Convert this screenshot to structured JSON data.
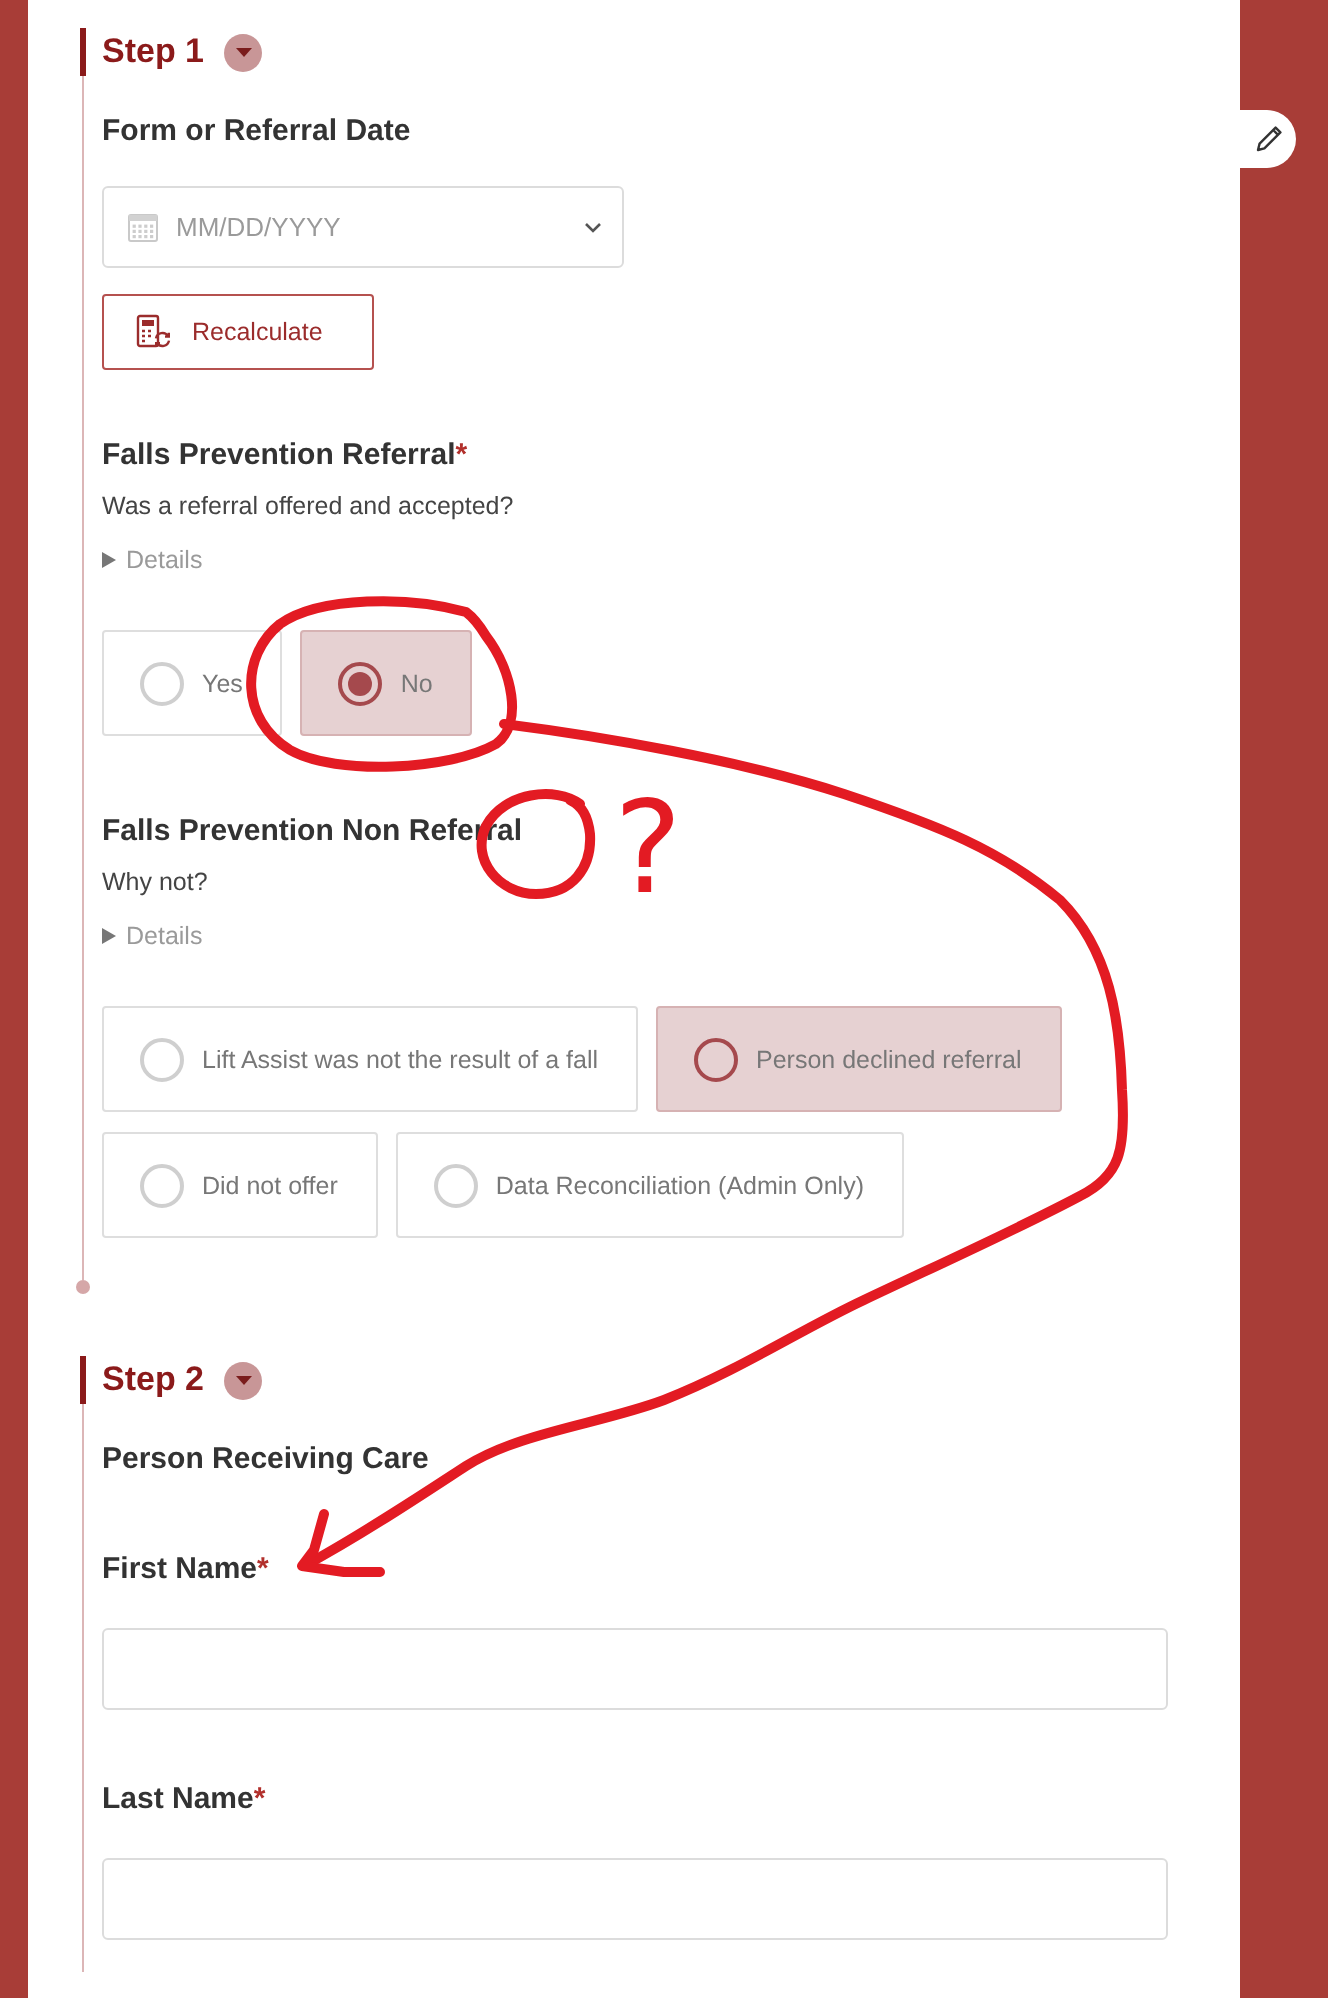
{
  "steps": [
    {
      "title": "Step 1",
      "expanded": true,
      "fields": [
        {
          "kind": "date",
          "label": "Form or Referral Date",
          "placeholder": "MM/DD/YYYY"
        },
        {
          "kind": "button",
          "label": "Recalculate"
        },
        {
          "kind": "choice",
          "label": "Falls Prevention Referral",
          "required_mark": "*",
          "hint": "Was a referral offered and accepted?",
          "details": {
            "label": "Details",
            "expanded": false
          },
          "options": [
            {
              "label": "Yes",
              "selected": false,
              "checked": false
            },
            {
              "label": "No",
              "selected": true,
              "checked": true
            }
          ]
        },
        {
          "kind": "choice",
          "label": "Falls Prevention Non Referral",
          "hint": "Why not?",
          "details": {
            "label": "Details",
            "expanded": false
          },
          "options": [
            {
              "label": "Lift Assist was not the result of a fall",
              "selected": false,
              "checked": false
            },
            {
              "label": "Person declined referral",
              "selected": true,
              "checked": false
            },
            {
              "label": "Did not offer",
              "selected": false,
              "checked": false
            },
            {
              "label": "Data Reconciliation (Admin Only)",
              "selected": false,
              "checked": false
            }
          ]
        }
      ]
    },
    {
      "title": "Step 2",
      "expanded": true,
      "fields": [
        {
          "kind": "heading",
          "label": "Person Receiving Care"
        },
        {
          "kind": "text",
          "label": "First Name",
          "required_mark": "*"
        },
        {
          "kind": "text",
          "label": "Last Name",
          "required_mark": "*"
        }
      ]
    }
  ],
  "annotation": {
    "question_mark": "?"
  }
}
